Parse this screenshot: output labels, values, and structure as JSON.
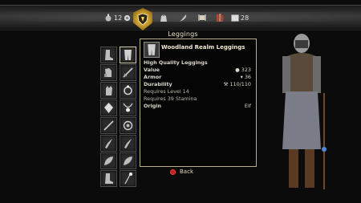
{
  "top_bar": {
    "gold_count": "12",
    "right_count": "28",
    "section_title": "Leggings"
  },
  "item": {
    "name": "Woodland Realm Leggings",
    "quality": "High Quality Leggings",
    "value_label": "Value",
    "value": "323",
    "armor_label": "Armor",
    "armor": "36",
    "durability_label": "Durability",
    "durability": "110/110",
    "req_level": "Requires Level 14",
    "req_stamina": "Requires 39 Stamina",
    "origin_label": "Origin",
    "origin": "Elf"
  },
  "footer": {
    "back_label": "Back"
  },
  "icons": {
    "categories": [
      "potion-icon",
      "armor-shield-icon",
      "bag-icon",
      "feather-icon",
      "scroll-icon",
      "books-icon",
      "card-icon"
    ],
    "slots": [
      "boot-icon",
      "leg-armor-icon",
      "gauntlet-icon",
      "sword-icon",
      "glove-icon",
      "ring-icon",
      "gem-icon",
      "necklace-icon",
      "sword-icon",
      "ring-icon",
      "claw-icon",
      "claw-icon",
      "leaf-icon",
      "leaf-icon",
      "boot-icon",
      "staff-icon"
    ]
  },
  "colors": {
    "accent_gold": "#c69a2b",
    "frame": "#b9ad8a",
    "back_button": "#c91c1c"
  }
}
